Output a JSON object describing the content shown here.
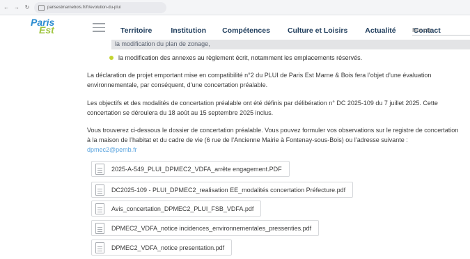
{
  "browser": {
    "url": "parisestmarnebois.fr/fr/evolution-du-plui"
  },
  "header": {
    "logo": {
      "line1": "Paris",
      "line2": "Est"
    },
    "menu": [
      "Territoire",
      "Institution",
      "Compétences",
      "Culture et Loisirs",
      "Actualité",
      "Contact"
    ],
    "search_placeholder": "Mot clé"
  },
  "content": {
    "truncated_line": "la modification du plan de zonage,",
    "bullet_item": "la modification des annexes au règlement écrit, notamment les emplacements réservés.",
    "paragraph1": "La déclaration de projet emportant mise en compatibilité n°2 du PLUI de Paris Est Marne & Bois fera l’objet d’une évaluation environnementale, par conséquent, d’une concertation préalable.",
    "paragraph2": "Les objectifs et des modalités de concertation préalable ont été définis par délibération n° DC 2025-109 du 7 juillet 2025. Cette concertation se déroulera du 18 août au 15 septembre 2025 inclus.",
    "paragraph3": "Vous trouverez ci-dessous le dossier de concertation préalable. Vous pouvez formuler vos observations sur le registre de concertation à la maison de l’habitat et du cadre de vie (6 rue de l’Ancienne Mairie à Fontenay-sous-Bois) ou l’adresse suivante :",
    "email": "dpmec2@pemb.fr"
  },
  "documents": [
    "2025-A-549_PLUI_DPMEC2_VDFA_arrête engagement.PDF",
    "DC2025-109 - PLUI_DPMEC2_realisation EE_modalités concertation Préfecture.pdf",
    "Avis_concertation_DPMEC2_PLUI_FSB_VDFA.pdf",
    "DPMEC2_VDFA_notice incidences_environnementales_pressenties.pdf",
    "DPMEC2_VDFA_notice presentation.pdf"
  ],
  "colors": {
    "menu_text": "#1f3d5c",
    "link": "#5aa4df",
    "bullet": "#c3d531",
    "logo_blue": "#2a8bd0",
    "logo_green": "#9ec43c"
  }
}
